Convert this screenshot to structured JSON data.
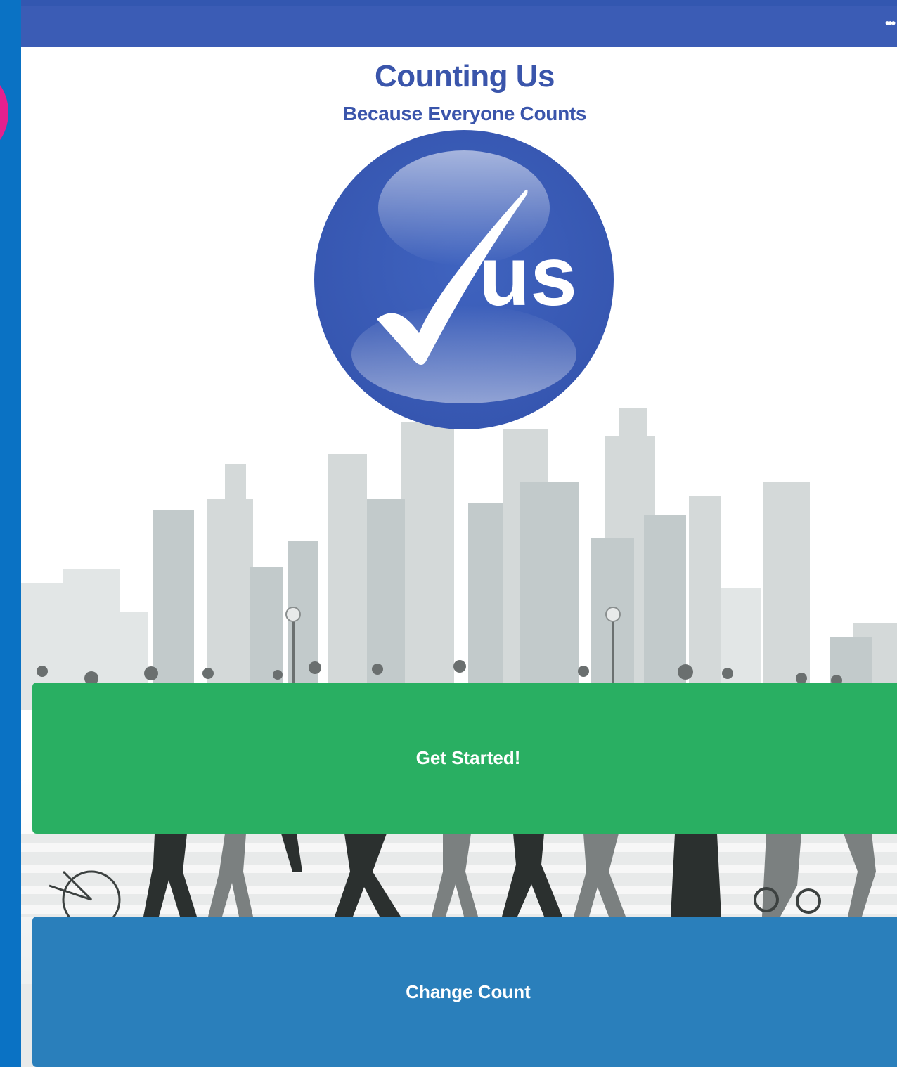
{
  "appbar": {
    "menu_icon": "more-dots-icon",
    "menu_glyph": "•••"
  },
  "header": {
    "title": "Counting Us",
    "subtitle": "Because Everyone Counts"
  },
  "logo": {
    "text": "us",
    "icon": "checkmark-icon"
  },
  "actions": {
    "get_started_label": "Get Started!",
    "change_count_label": "Change Count"
  },
  "colors": {
    "appbar": "#3b5cb5",
    "brand_blue": "#3a55ab",
    "get_started": "#29af62",
    "change_count": "#2a7fbb",
    "left_strip": "#0a72c4",
    "accent_pink": "#e5208e"
  }
}
